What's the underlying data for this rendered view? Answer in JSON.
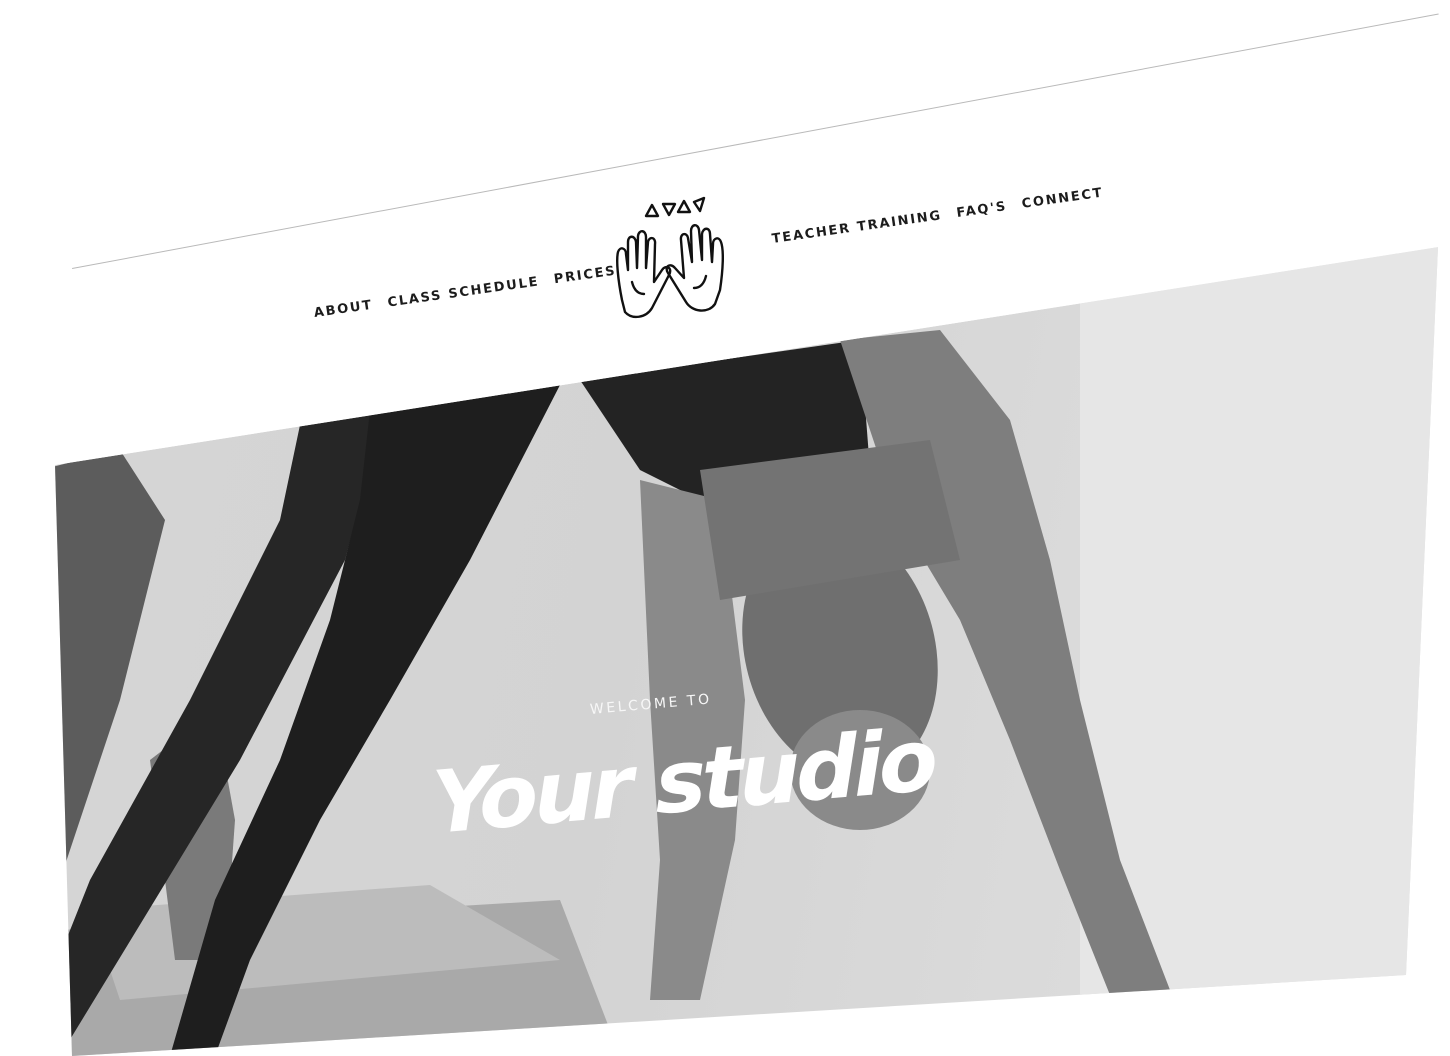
{
  "nav": {
    "left": [
      {
        "label": "ABOUT"
      },
      {
        "label": "CLASS SCHEDULE"
      },
      {
        "label": "PRICES"
      }
    ],
    "right": [
      {
        "label": "TEACHER TRAINING"
      },
      {
        "label": "FAQ'S"
      },
      {
        "label": "CONNECT"
      }
    ]
  },
  "logo": {
    "icon": "raised-hands-with-triangles-icon"
  },
  "hero": {
    "eyebrow": "WELCOME TO",
    "title": "Your studio",
    "image": "black-and-white-yoga-forward-fold-photo"
  },
  "colors": {
    "text": "#1c1c1c",
    "hero_text": "#ffffff",
    "background": "#ffffff"
  }
}
